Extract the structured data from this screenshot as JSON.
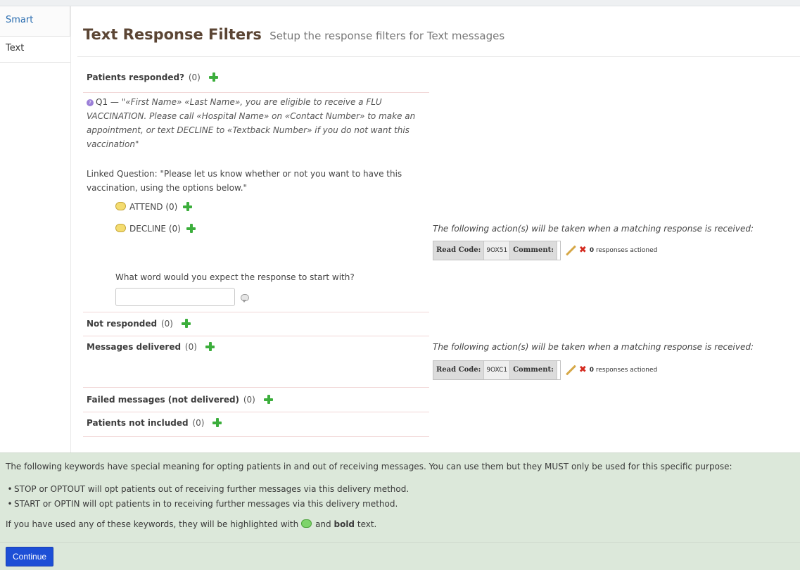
{
  "nav": {
    "tabs": [
      "Smart",
      "Text"
    ]
  },
  "header": {
    "title": "Text Response Filters",
    "subtitle": "Setup the response filters for Text messages"
  },
  "sections": {
    "responded": {
      "title": "Patients responded?",
      "count": "(0)"
    },
    "not_responded": {
      "title": "Not responded",
      "count": "(0)"
    },
    "delivered": {
      "title": "Messages delivered",
      "count": "(0)"
    },
    "failed": {
      "title": "Failed messages (not delivered)",
      "count": "(0)"
    },
    "not_included": {
      "title": "Patients not included",
      "count": "(0)"
    }
  },
  "question": {
    "number": "Q1 —",
    "text": "\"«First Name» «Last Name», you are eligible to receive a FLU VACCINATION. Please call «Hospital Name» on «Contact Number» to make an appointment, or text DECLINE to «Textback Number» if you do not want this vaccination\"",
    "linked": "Linked Question: \"Please let us know whether or not you want to have this vaccination, using the options below.\""
  },
  "responses": [
    {
      "label": "ATTEND",
      "count": "(0)"
    },
    {
      "label": "DECLINE",
      "count": "(0)"
    }
  ],
  "expect": {
    "label": "What word would you expect the response to start with?",
    "value": ""
  },
  "actions": {
    "intro": "The following action(s) will be taken when a matching response is received:",
    "read_code_label": "Read Code:",
    "comment_label": "Comment:",
    "decline_code": "9OX51",
    "delivered_code": "9OXC1",
    "actioned_count": "0",
    "actioned_text": "responses actioned"
  },
  "info": {
    "intro": "The following keywords have special meaning for opting patients in and out of receiving messages. You can use them but they MUST only be used for this specific purpose:",
    "bullets": [
      "STOP or OPTOUT will opt patients out of receiving further messages via this delivery method.",
      "START or OPTIN will opt patients in to receiving further messages via this delivery method."
    ],
    "note_before": "If you have used any of these keywords, they will be highlighted with",
    "note_and": "and",
    "note_bold": "bold",
    "note_after": "text."
  },
  "footer": {
    "continue_label": "Continue"
  }
}
